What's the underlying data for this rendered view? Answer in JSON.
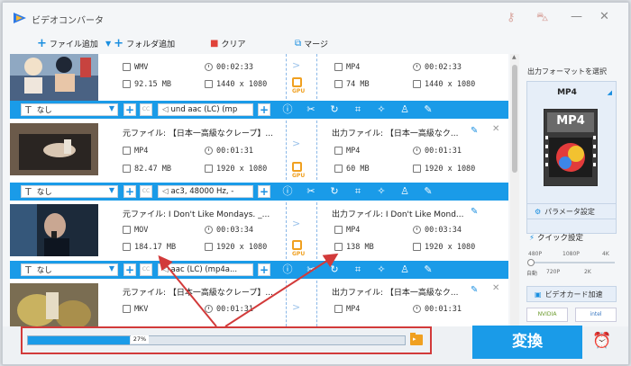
{
  "app": {
    "title": "ビデオコンバータ"
  },
  "toolbar": {
    "add_file": "ファイル追加",
    "add_folder": "フォルダ追加",
    "clear": "クリア",
    "merge": "マージ"
  },
  "files": [
    {
      "input": {
        "format": "WMV",
        "duration": "00:02:33",
        "size": "92.15 MB",
        "resolution": "1440 x 1080"
      },
      "output": {
        "format": "MP4",
        "duration": "00:02:33",
        "size": "74 MB",
        "resolution": "1440 x 1080"
      },
      "subtitle": "なし",
      "audio": "und aac (LC) (mp"
    },
    {
      "input": {
        "name": "元ファイル: 【日本一高級なクレープ】...",
        "format": "MP4",
        "duration": "00:01:31",
        "size": "82.47 MB",
        "resolution": "1920 x 1080"
      },
      "output": {
        "name": "出力ファイル: 【日本一高級なク...",
        "format": "MP4",
        "duration": "00:01:31",
        "size": "60 MB",
        "resolution": "1920 x 1080"
      },
      "subtitle": "なし",
      "audio": "ac3, 48000 Hz, -"
    },
    {
      "input": {
        "name": "元ファイル: I Don't Like Mondays. _...",
        "format": "MOV",
        "duration": "00:03:34",
        "size": "184.17 MB",
        "resolution": "1920 x 1080"
      },
      "output": {
        "name": "出力ファイル: I Don't Like Mond...",
        "format": "MP4",
        "duration": "00:03:34",
        "size": "138 MB",
        "resolution": "1920 x 1080"
      },
      "subtitle": "なし",
      "audio": "aac (LC) (mp4a..."
    },
    {
      "input": {
        "name": "元ファイル: 【日本一高級なクレープ】...",
        "format": "MKV",
        "duration": "00:01:31"
      },
      "output": {
        "name": "出力ファイル: 【日本一高級なク...",
        "format": "MP4",
        "duration": "00:01:31"
      }
    }
  ],
  "gpu_label": "GPU",
  "progress": {
    "value": 0.27,
    "label": "27%"
  },
  "convert_button": "変換",
  "right_panel": {
    "output_format_title": "出力フォーマットを選択",
    "selected_format": "MP4",
    "format_badge": "MP4",
    "param_button": "パラメータ設定",
    "quick_settings": "クイック設定",
    "quality_top": [
      "480P",
      "1080P",
      "4K"
    ],
    "quality_bottom": [
      "自動",
      "720P",
      "2K"
    ],
    "gpu_accel": "ビデオカード加速",
    "vendors": [
      "NVIDIA",
      "intel"
    ]
  },
  "colors": {
    "accent": "#1a9be8",
    "annotation": "#d23a3a",
    "gpu": "#f0a020"
  }
}
